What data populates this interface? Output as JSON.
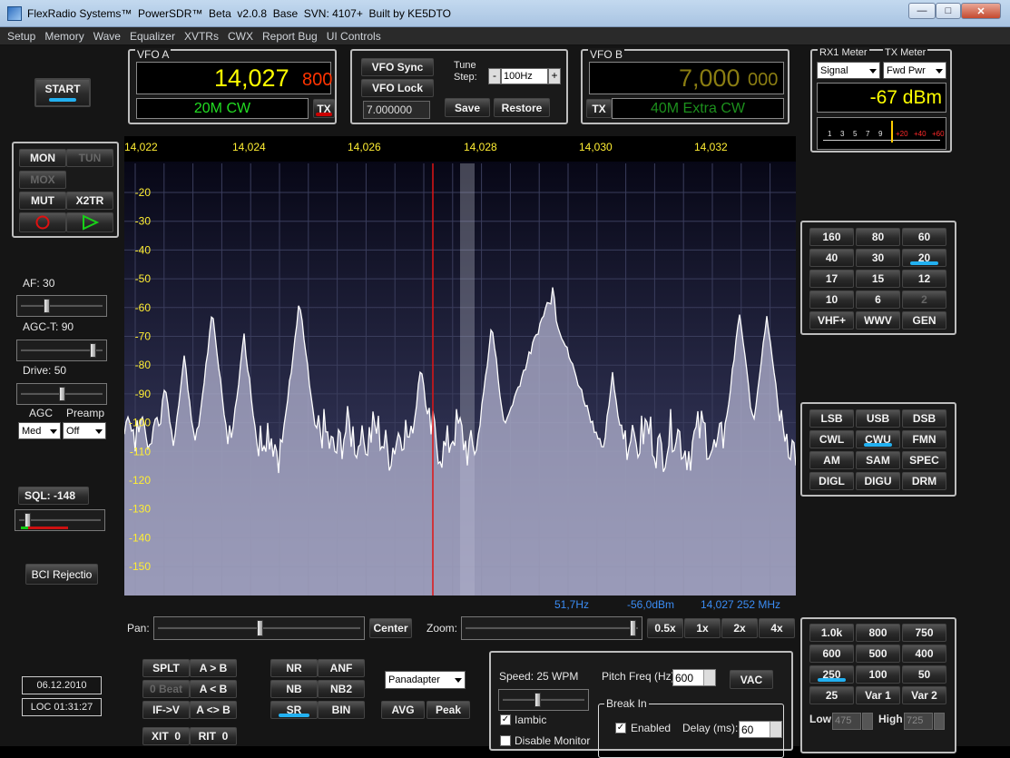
{
  "window": {
    "title": "FlexRadio Systems™  PowerSDR™  Beta  v2.0.8  Base  SVN: 4107+  Built by KE5DTO",
    "minimize": "—",
    "maximize": "□",
    "close": "✕"
  },
  "menu": [
    "Setup",
    "Memory",
    "Wave",
    "Equalizer",
    "XVTRs",
    "CWX",
    "Report Bug",
    "UI Controls"
  ],
  "start_label": "START",
  "left_buttons": {
    "mon": "MON",
    "tun": "TUN",
    "mox": "MOX",
    "mut": "MUT",
    "x2tr": "X2TR"
  },
  "af": {
    "label": "AF:",
    "value": "30",
    "level": 0.3
  },
  "agct": {
    "label": "AGC-T:",
    "value": "90",
    "level": 0.9
  },
  "drive": {
    "label": "Drive:",
    "value": "50",
    "level": 0.5
  },
  "agc": {
    "label": "AGC",
    "selected": "Med"
  },
  "preamp": {
    "label": "Preamp",
    "selected": "Off"
  },
  "sql": {
    "label": "SQL: -148",
    "level": 0.08
  },
  "bci_label": "BCI Rejectio",
  "date": "06.12.2010",
  "time": "LOC 01:31:27",
  "vfoa": {
    "title": "VFO A",
    "freq_main": "14,027",
    "freq_sub": "800",
    "mode": "20M CW",
    "tx": "TX"
  },
  "vfo_mid": {
    "sync": "VFO Sync",
    "lock": "VFO Lock",
    "tune_label": "Tune\nStep:",
    "step_minus": "-",
    "step": "100Hz",
    "step_plus": "+",
    "freq_entry": "7.000000",
    "save": "Save",
    "restore": "Restore"
  },
  "vfob": {
    "title": "VFO B",
    "freq_main": "7,000",
    "freq_sub": "000",
    "mode": "40M Extra CW",
    "tx": "TX"
  },
  "meter": {
    "rx_label": "RX1 Meter",
    "tx_label": "TX Meter",
    "rx_sel": "Signal",
    "tx_sel": "Fwd Pwr",
    "reading": "-67 dBm",
    "scale": [
      "1",
      "3",
      "5",
      "7",
      "9",
      "+20",
      "+40",
      "+60"
    ],
    "level": 0.58
  },
  "spectrum": {
    "freq_ticks": [
      "14,022",
      "14,024",
      "14,026",
      "14,028",
      "14,030",
      "14,032"
    ],
    "db_ticks": [
      "-20",
      "-30",
      "-40",
      "-50",
      "-60",
      "-70",
      "-80",
      "-90",
      "-100",
      "-110",
      "-120",
      "-130",
      "-140",
      "-150"
    ],
    "readout_hz": "51,7Hz",
    "readout_dbm": "-56,0dBm",
    "readout_mhz": "14,027 252 MHz",
    "peaks_note": ""
  },
  "pan": {
    "label": "Pan:",
    "center": "Center",
    "level": 0.5
  },
  "zoom": {
    "label": "Zoom:",
    "level": 0.98,
    "buttons": [
      "0.5x",
      "1x",
      "2x",
      "4x"
    ]
  },
  "bands": [
    "160",
    "80",
    "60",
    "40",
    "30",
    "20",
    "17",
    "15",
    "12",
    "10",
    "6",
    "2",
    "VHF+",
    "WWV",
    "GEN"
  ],
  "selected_band": "20",
  "modes": [
    "LSB",
    "USB",
    "DSB",
    "CWL",
    "CWU",
    "FMN",
    "AM",
    "SAM",
    "SPEC",
    "DIGL",
    "DIGU",
    "DRM"
  ],
  "selected_mode": "CWU",
  "filters": [
    "1.0k",
    "800",
    "750",
    "600",
    "500",
    "400",
    "250",
    "100",
    "50",
    "25",
    "Var 1",
    "Var 2"
  ],
  "selected_filter": "250",
  "filter_low": {
    "label": "Low",
    "value": "475"
  },
  "filter_high": {
    "label": "High",
    "value": "725"
  },
  "vfo_ops": [
    "SPLT",
    "A > B",
    "0 Beat",
    "A < B",
    "IF->V",
    "A <> B"
  ],
  "xit": {
    "label": "XIT",
    "value": "0"
  },
  "rit": {
    "label": "RIT",
    "value": "0"
  },
  "dsp": [
    "NR",
    "ANF",
    "NB",
    "NB2",
    "SR",
    "BIN"
  ],
  "display_mode": "Panadapter",
  "avg": "AVG",
  "peak": "Peak",
  "cw": {
    "speed": "Speed:  25 WPM",
    "speed_level": 0.42,
    "pitch_label": "Pitch Freq (Hz):",
    "pitch": "600",
    "vac": "VAC",
    "iambic": "Iambic",
    "disable_monitor": "Disable Monitor",
    "break_in": "Break In",
    "enabled": "Enabled",
    "delay_label": "Delay (ms):",
    "delay": "60"
  },
  "colors": {
    "vfoa_freq": "#ffff00",
    "vfoa_sub": "#ff3300",
    "vfob_freq": "#8a7d12",
    "mode_text": "#22dd22",
    "accent": "#22b0f0",
    "tx_red": "#cc0000"
  }
}
